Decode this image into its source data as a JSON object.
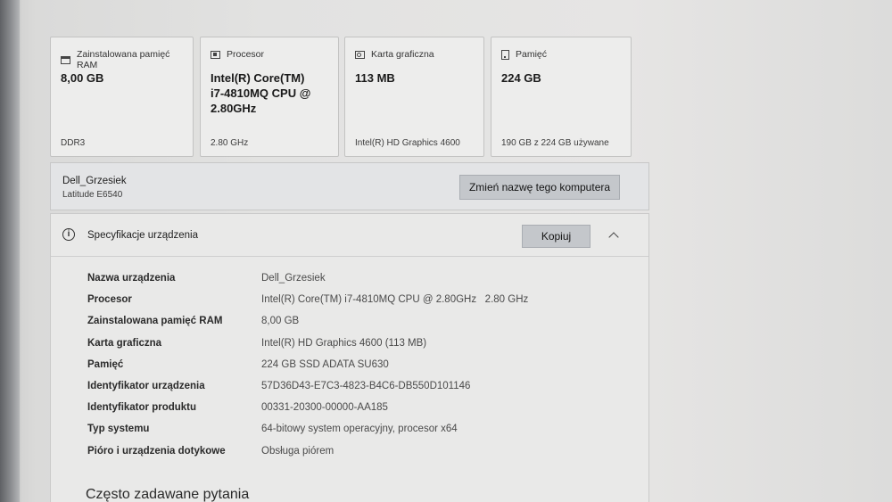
{
  "cards": [
    {
      "title": "Zainstalowana pamięć RAM",
      "value": "8,00 GB",
      "sub": "DDR3",
      "icon": "memory-icon"
    },
    {
      "title": "Procesor",
      "value": "Intel(R) Core(TM) i7-4810MQ CPU @ 2.80GHz",
      "sub": "2.80 GHz",
      "icon": "processor-icon"
    },
    {
      "title": "Karta graficzna",
      "value": "113 MB",
      "sub": "Intel(R) HD Graphics 4600",
      "icon": "graphics-card-icon"
    },
    {
      "title": "Pamięć",
      "value": "224 GB",
      "sub": "190 GB z 224 GB używane",
      "icon": "storage-icon"
    }
  ],
  "device": {
    "name": "Dell_Grzesiek",
    "model": "Latitude E6540",
    "rename_label": "Zmień nazwę tego komputera"
  },
  "spec": {
    "title": "Specyfikacje urządzenia",
    "copy_label": "Kopiuj",
    "rows": [
      {
        "label": "Nazwa urządzenia",
        "value": "Dell_Grzesiek"
      },
      {
        "label": "Procesor",
        "value": "Intel(R) Core(TM) i7-4810MQ CPU @ 2.80GHz   2.80 GHz"
      },
      {
        "label": "Zainstalowana pamięć RAM",
        "value": "8,00 GB"
      },
      {
        "label": "Karta graficzna",
        "value": "Intel(R) HD Graphics 4600 (113 MB)"
      },
      {
        "label": "Pamięć",
        "value": "224 GB SSD ADATA SU630"
      },
      {
        "label": "Identyfikator urządzenia",
        "value": "57D36D43-E7C3-4823-B4C6-DB550D101146"
      },
      {
        "label": "Identyfikator produktu",
        "value": "00331-20300-00000-AA185"
      },
      {
        "label": "Typ systemu",
        "value": "64-bitowy system operacyjny, procesor x64"
      },
      {
        "label": "Pióro i urządzenia dotykowe",
        "value": "Obsługa piórem"
      }
    ]
  },
  "faq_title": "Często zadawane pytania"
}
